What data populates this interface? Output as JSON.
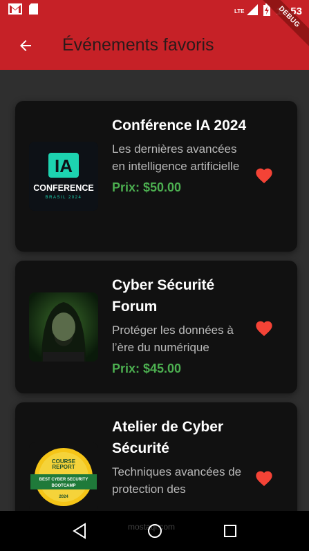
{
  "status_bar": {
    "time": "11:53",
    "network": "LTE",
    "icons": [
      "gmail-icon",
      "sd-card-icon",
      "signal-icon",
      "battery-icon"
    ]
  },
  "debug_banner": "DEBUG",
  "appbar": {
    "title": "Événements favoris",
    "back_icon": "arrow-back-icon"
  },
  "events": [
    {
      "title": "Conférence IA 2024",
      "description": "Les dernières avancées en intelligence artificielle",
      "price": "Prix: $50.00",
      "image": {
        "main": "IA",
        "sub": "CONFERENCE",
        "tag": "BRASIL 2024"
      },
      "favorite": true
    },
    {
      "title": "Cyber Sécurité Forum",
      "description": "Protéger les données à l’ère du numérique",
      "price": "Prix: $45.00",
      "image": {
        "kind": "hooded-figure"
      },
      "favorite": true
    },
    {
      "title": "Atelier de Cyber Sécurité",
      "description": "Techniques avancées de protection des",
      "price": "",
      "image": {
        "line1": "COURSE",
        "line2": "REPORT",
        "banner1": "BEST CYBER SECURITY",
        "banner2": "BOOTCAMP",
        "year": "2024"
      },
      "favorite": true
    }
  ],
  "watermark": "mostaql.com",
  "colors": {
    "appbar": "#c62127",
    "background": "#2f2f2f",
    "card": "#111111",
    "price": "#4caf50",
    "heart": "#f44336"
  },
  "nav": [
    "back-nav-icon",
    "home-nav-icon",
    "recents-nav-icon"
  ]
}
